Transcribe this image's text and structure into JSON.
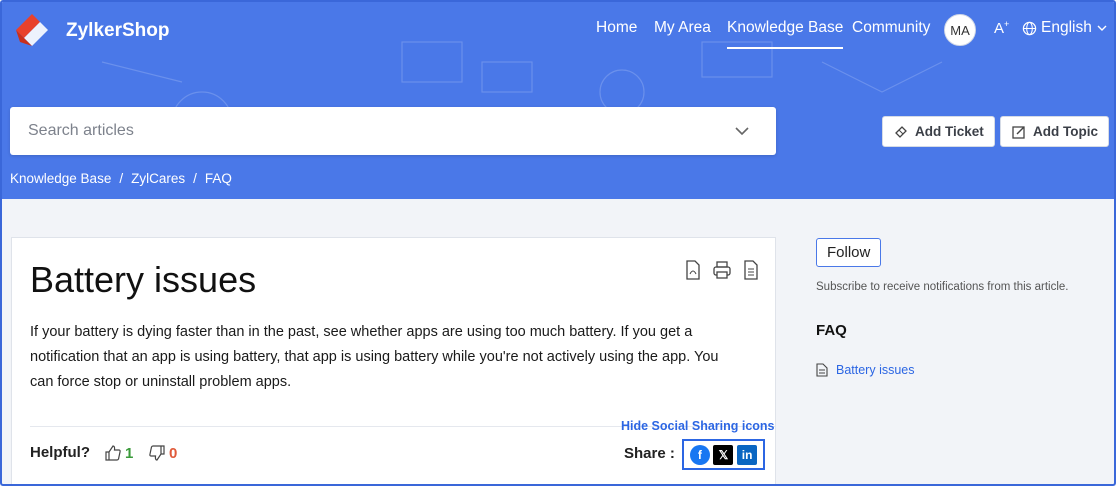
{
  "header": {
    "brand": "ZylkerShop",
    "nav": [
      "Home",
      "My Area",
      "Knowledge Base",
      "Community"
    ],
    "active_nav": "Knowledge Base",
    "avatar_initials": "MA",
    "font_size_label": "A",
    "language": "English"
  },
  "search": {
    "placeholder": "Search articles"
  },
  "actions": {
    "add_ticket": "Add Ticket",
    "add_topic": "Add Topic"
  },
  "breadcrumb": [
    "Knowledge Base",
    "ZylCares",
    "FAQ"
  ],
  "article": {
    "title": "Battery issues",
    "body": "If your battery is dying faster than in the past, see whether apps are using too much battery. If you get a notification that an app is using battery, that app is using battery while you're not actively using the app. You can force stop or uninstall problem apps.",
    "helpful_label": "Helpful?",
    "likes": "1",
    "dislikes": "0",
    "hide_social": "Hide Social Sharing icons",
    "share_label": "Share :"
  },
  "sidebar": {
    "follow": "Follow",
    "follow_note": "Subscribe to receive notifications from this article.",
    "section_title": "FAQ",
    "items": [
      "Battery issues"
    ]
  },
  "colors": {
    "primary": "#4a78e8",
    "link": "#2c66e3",
    "like": "#3a9a3a",
    "dislike": "#e05a3a"
  }
}
